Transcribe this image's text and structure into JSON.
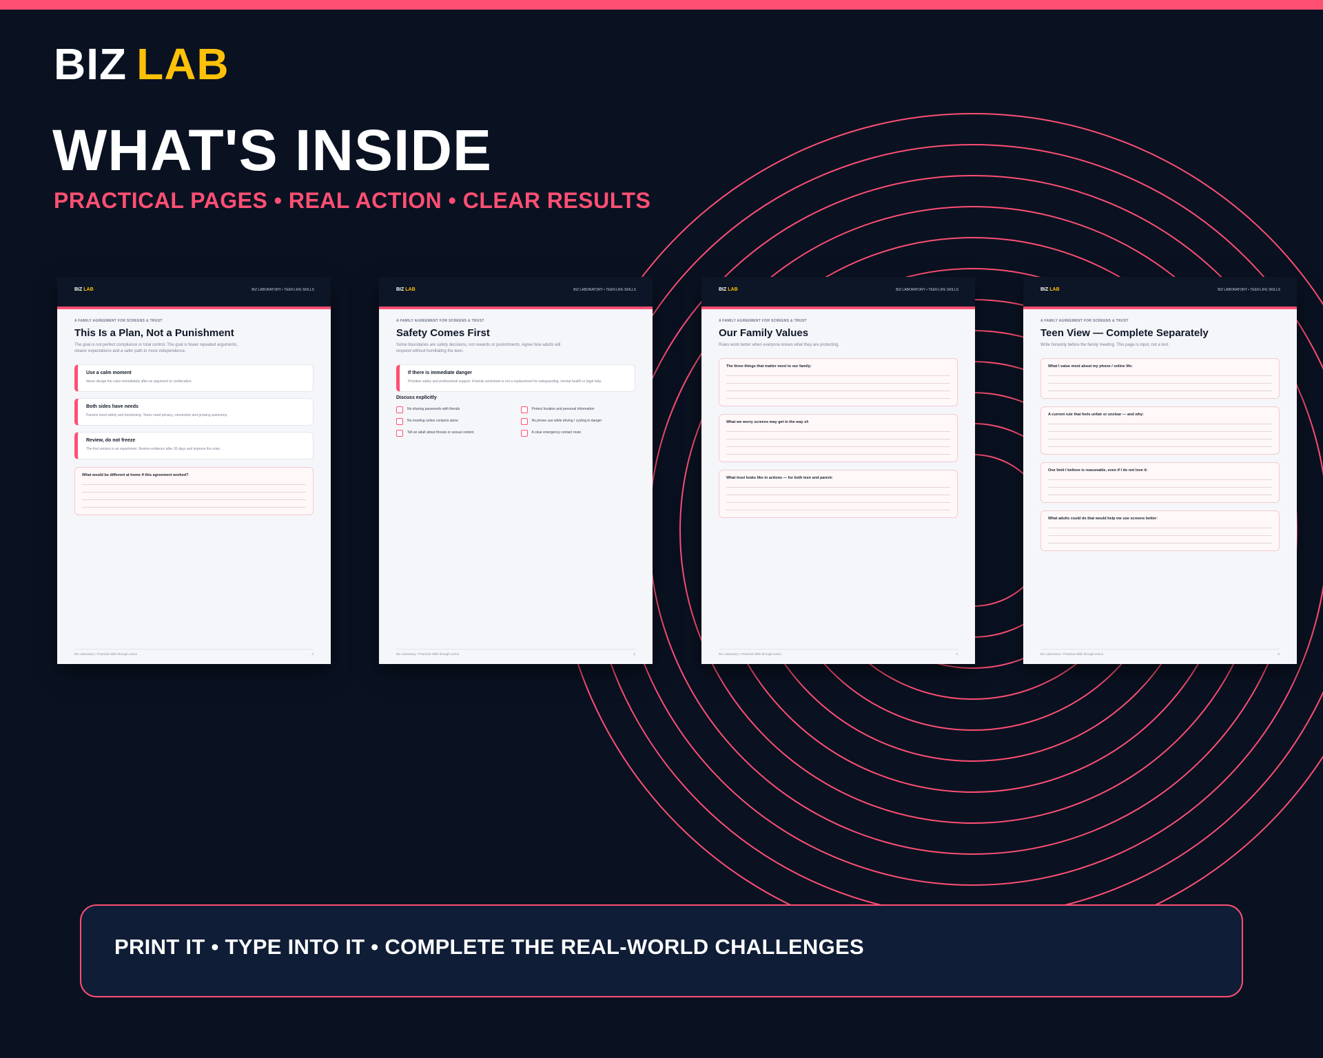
{
  "accent_color": "#ff4f73",
  "brand": {
    "biz": "BIZ",
    "lab": "LAB"
  },
  "headline": "WHAT'S INSIDE",
  "tagline": "PRACTICAL PAGES • REAL ACTION • CLEAR RESULTS",
  "page_header_right": "BIZ LABORATORY • TEEN LIFE SKILLS",
  "eyebrow": "A FAMILY AGREEMENT FOR SCREENS & TRUST",
  "footer_left": "Biz Laboratory • Practical skills through action",
  "pages": [
    {
      "title": "This Is a Plan, Not a Punishment",
      "subtitle": "The goal is not perfect compliance or total control. The goal is fewer repeated arguments, clearer expectations and a safer path to more independence.",
      "cards": [
        {
          "title": "Use a calm moment",
          "text": "Never design the rules immediately after an argument or confiscation."
        },
        {
          "title": "Both sides have needs",
          "text": "Parents need safety and functioning. Teens need privacy, connection and growing autonomy."
        },
        {
          "title": "Review, do not freeze",
          "text": "The first version is an experiment. Review evidence after 30 days and improve the rules."
        }
      ],
      "prompts": [
        "What would be different at home if this agreement worked?"
      ],
      "page_number": "2"
    },
    {
      "title": "Safety Comes First",
      "subtitle": "Some boundaries are safety decisions, not rewards or punishments. Agree how adults will respond without humiliating the teen.",
      "cards": [
        {
          "title": "If there is immediate danger",
          "text": "Prioritise safety and professional support. A family worksheet is not a replacement for safeguarding, mental-health or legal help."
        }
      ],
      "discuss_title": "Discuss explicitly",
      "checks": [
        "No sharing passwords with friends",
        "Protect location and personal information",
        "No meeting online contacts alone",
        "No phone use while driving / cycling in danger",
        "Tell an adult about threats or sexual content",
        "A clear emergency contact route"
      ],
      "page_number": "3"
    },
    {
      "title": "Our Family Values",
      "subtitle": "Rules work better when everyone knows what they are protecting.",
      "prompts": [
        "The three things that matter most to our family:",
        "What we worry screens may get in the way of:",
        "What trust looks like in actions — for both teen and parent:"
      ],
      "page_number": "4"
    },
    {
      "title": "Teen View — Complete Separately",
      "subtitle": "Write honestly before the family meeting. This page is input, not a test.",
      "prompts": [
        "What I value most about my phone / online life:",
        "A current rule that feels unfair or unclear — and why:",
        "One limit I believe is reasonable, even if I do not love it:",
        "What adults could do that would help me use screens better:"
      ],
      "page_number": "5"
    }
  ],
  "cta": "PRINT IT • TYPE INTO IT • COMPLETE THE REAL-WORLD CHALLENGES"
}
